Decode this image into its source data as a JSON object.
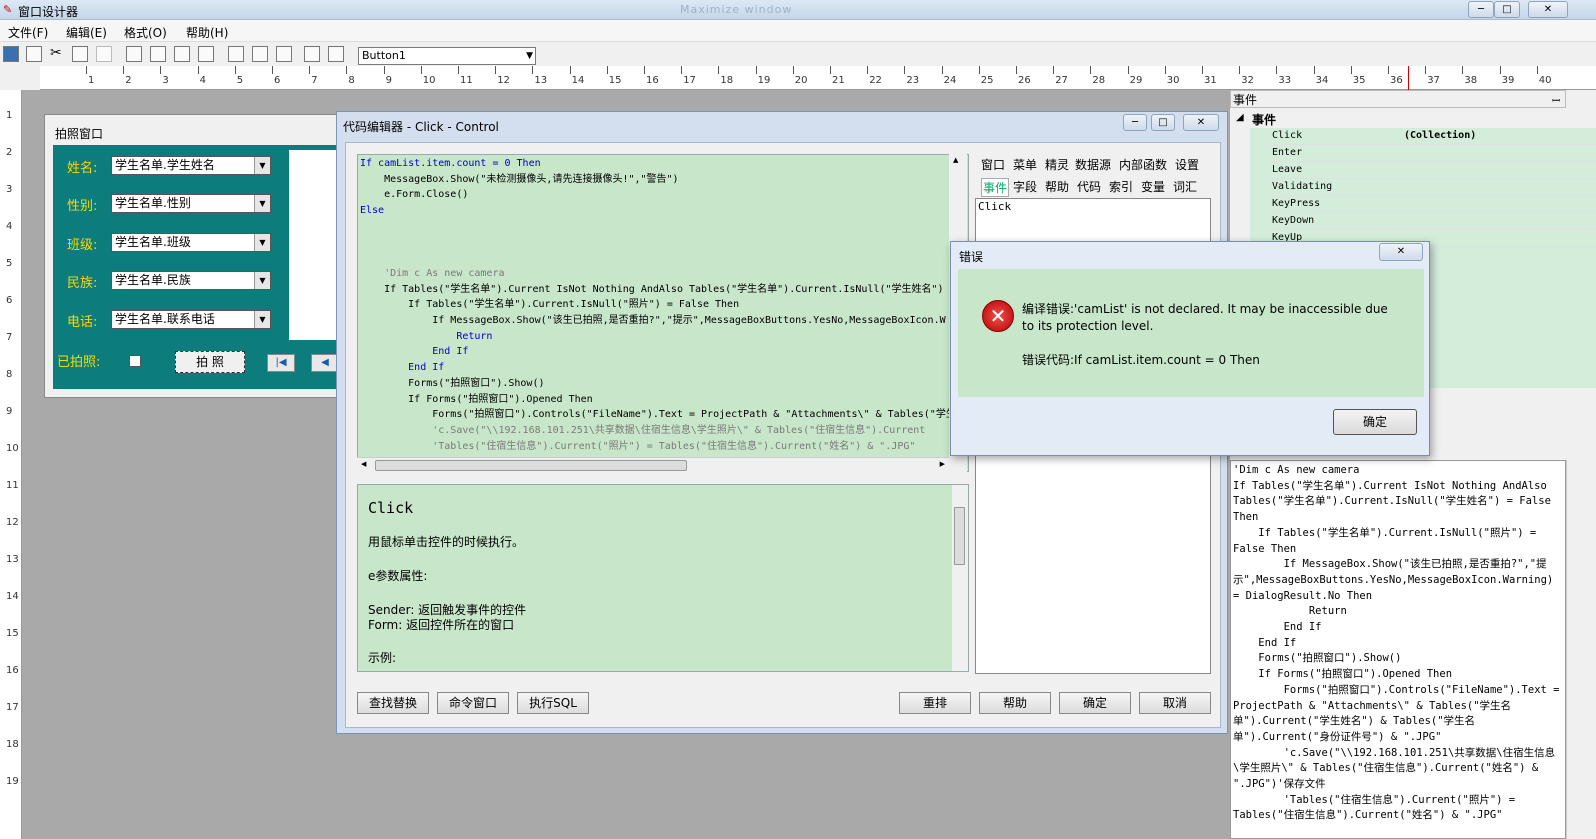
{
  "app": {
    "title": "窗口设计器",
    "blurred_title": "Maximize window"
  },
  "window_buttons": {
    "min": "─",
    "max": "□",
    "close": "✕"
  },
  "menu": [
    "文件(F)",
    "编辑(E)",
    "格式(O)",
    "帮助(H)"
  ],
  "toolbar": {
    "control_combo": "Button1"
  },
  "ruler": {
    "numbers": [
      "1",
      "2",
      "3",
      "4",
      "5",
      "6",
      "7",
      "8",
      "9",
      "10",
      "11",
      "12",
      "13",
      "14",
      "15",
      "16",
      "17",
      "18",
      "19",
      "20",
      "21",
      "22",
      "23",
      "24",
      "25",
      "26",
      "27",
      "28",
      "29",
      "30",
      "31",
      "32",
      "33",
      "34",
      "35",
      "36",
      "37",
      "38",
      "39",
      "40"
    ],
    "v_numbers": [
      "1",
      "2",
      "3",
      "4",
      "5",
      "6",
      "7",
      "8",
      "9",
      "10",
      "11",
      "12",
      "13",
      "14",
      "15",
      "16",
      "17",
      "18",
      "19"
    ]
  },
  "form": {
    "title": "拍照窗口",
    "fields": [
      {
        "label": "姓名:",
        "value": "学生名单.学生姓名"
      },
      {
        "label": "性别:",
        "value": "学生名单.性别"
      },
      {
        "label": "班级:",
        "value": "学生名单.班级"
      },
      {
        "label": "民族:",
        "value": "学生名单.民族"
      },
      {
        "label": "电话:",
        "value": "学生名单.联系电话"
      }
    ],
    "photographed_label": "已拍照:",
    "photo_button": "拍 照"
  },
  "editor": {
    "title": "代码编辑器 - Click - Control",
    "code_lines": [
      {
        "t": "If camList.item.count = 0 Then",
        "c": "kw"
      },
      {
        "t": "    MessageBox.Show(\"未检测摄像头,请先连接摄像头!\",\"警告\")",
        "c": ""
      },
      {
        "t": "    e.Form.Close()",
        "c": ""
      },
      {
        "t": "Else",
        "c": "kw"
      },
      {
        "t": "",
        "c": ""
      },
      {
        "t": "",
        "c": ""
      },
      {
        "t": "",
        "c": ""
      },
      {
        "t": "    'Dim c As new camera",
        "c": "cm"
      },
      {
        "t": "    If Tables(\"学生名单\").Current IsNot Nothing AndAlso Tables(\"学生名单\").Current.IsNull(\"学生姓名\")",
        "c": ""
      },
      {
        "t": "        If Tables(\"学生名单\").Current.IsNull(\"照片\") = False Then",
        "c": ""
      },
      {
        "t": "            If MessageBox.Show(\"该生已拍照,是否重拍?\",\"提示\",MessageBoxButtons.YesNo,MessageBoxIcon.W",
        "c": ""
      },
      {
        "t": "                Return",
        "c": "kw"
      },
      {
        "t": "            End If",
        "c": "kw"
      },
      {
        "t": "        End If",
        "c": "kw"
      },
      {
        "t": "        Forms(\"拍照窗口\").Show()",
        "c": ""
      },
      {
        "t": "        If Forms(\"拍照窗口\").Opened Then",
        "c": ""
      },
      {
        "t": "            Forms(\"拍照窗口\").Controls(\"FileName\").Text = ProjectPath & \"Attachments\\\" & Tables(\"学生",
        "c": ""
      },
      {
        "t": "            'c.Save(\"\\\\192.168.101.251\\共享数据\\住宿生信息\\学生照片\\\" & Tables(\"住宿生信息\").Current",
        "c": "cm"
      },
      {
        "t": "            'Tables(\"住宿生信息\").Current(\"照片\") = Tables(\"住宿生信息\").Current(\"姓名\") & \".JPG\"",
        "c": "cm"
      }
    ],
    "help": {
      "title": "Click",
      "desc": "用鼠标单击控件的时候执行。",
      "params_title": "e参数属性:",
      "sender": "Sender: 返回触发事件的控件",
      "form": "Form:    返回控件所在的窗口",
      "example": "示例:"
    },
    "tabs_row1": [
      "窗口",
      "菜单",
      "精灵",
      "数据源",
      "内部函数",
      "设置"
    ],
    "tabs_row2": [
      "事件",
      "字段",
      "帮助",
      "代码",
      "索引",
      "变量",
      "词汇"
    ],
    "list_item": "Click",
    "buttons": {
      "find": "查找替换",
      "cmd": "命令窗口",
      "sql": "执行SQL",
      "rearrange": "重排",
      "help": "帮助",
      "ok": "确定",
      "cancel": "取消"
    }
  },
  "props": {
    "header": "事件",
    "pin": "ꟷ",
    "group": "事件",
    "rows": [
      {
        "name": "Click",
        "value": "(Collection)"
      },
      {
        "name": "Enter",
        "value": ""
      },
      {
        "name": "Leave",
        "value": ""
      },
      {
        "name": "Validating",
        "value": ""
      },
      {
        "name": "KeyPress",
        "value": ""
      },
      {
        "name": "KeyDown",
        "value": ""
      },
      {
        "name": "KeyUp",
        "value": ""
      }
    ]
  },
  "codeview": {
    "text": "'Dim c As new camera\nIf Tables(\"学生名单\").Current IsNot Nothing AndAlso Tables(\"学生名单\").Current.IsNull(\"学生姓名\") = False Then\n    If Tables(\"学生名单\").Current.IsNull(\"照片\") = False Then\n        If MessageBox.Show(\"该生已拍照,是否重拍?\",\"提示\",MessageBoxButtons.YesNo,MessageBoxIcon.Warning) = DialogResult.No Then\n            Return\n        End If\n    End If\n    Forms(\"拍照窗口\").Show()\n    If Forms(\"拍照窗口\").Opened Then\n        Forms(\"拍照窗口\").Controls(\"FileName\").Text = ProjectPath & \"Attachments\\\" & Tables(\"学生名单\").Current(\"学生姓名\") & Tables(\"学生名单\").Current(\"身份证件号\") & \".JPG\"\n        'c.Save(\"\\\\192.168.101.251\\共享数据\\住宿生信息\\学生照片\\\" & Tables(\"住宿生信息\").Current(\"姓名\") & \".JPG\")'保存文件\n        'Tables(\"住宿生信息\").Current(\"照片\") = Tables(\"住宿生信息\").Current(\"姓名\") & \".JPG\""
  },
  "error": {
    "title": "错误",
    "message": "编译错误:'camList' is not declared. It may be inaccessible due to its protection level.",
    "code_line": "错误代码:If camList.item.count = 0 Then",
    "ok": "确定",
    "close": "✕",
    "icon": "✕"
  }
}
